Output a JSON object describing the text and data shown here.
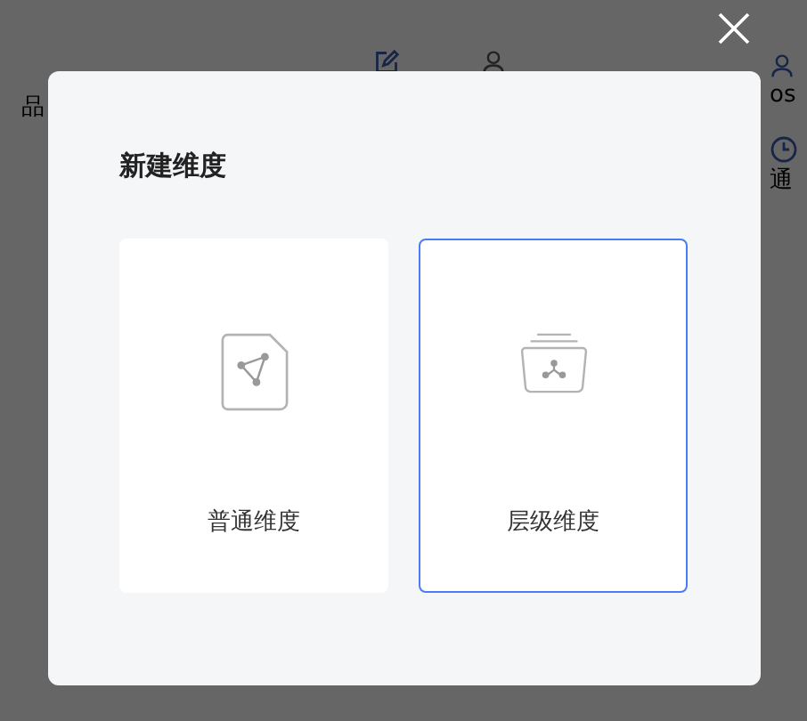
{
  "background": {
    "left": [
      "品"
    ],
    "right": [
      "os",
      "通"
    ]
  },
  "dialog": {
    "title": "新建维度",
    "options": [
      {
        "label": "普通维度",
        "kind": "flat",
        "selected": false
      },
      {
        "label": "层级维度",
        "kind": "hierarchy",
        "selected": true
      }
    ]
  }
}
